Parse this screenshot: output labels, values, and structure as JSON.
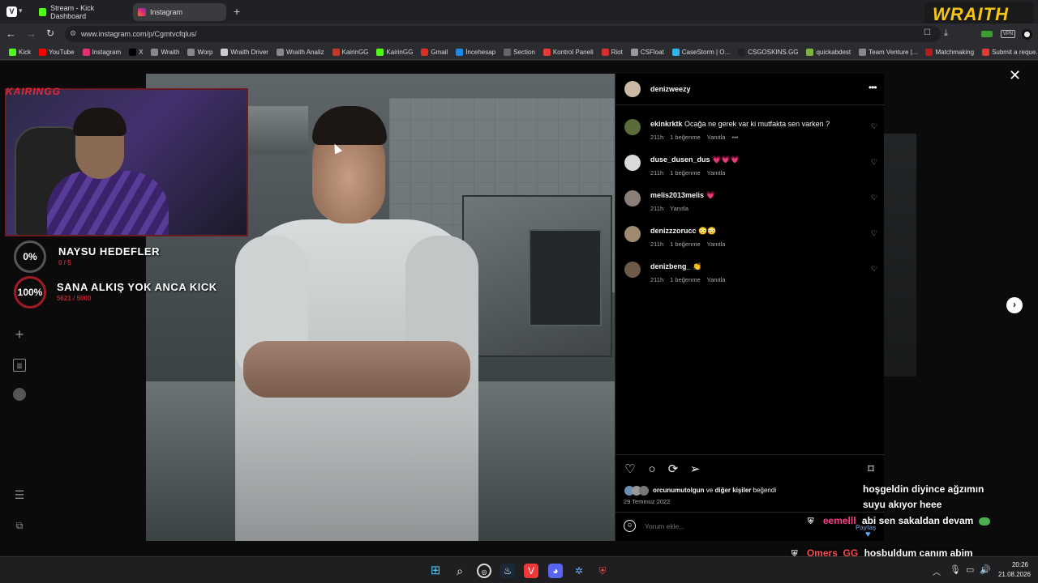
{
  "browser": {
    "tabs": [
      {
        "label": "Stream - Kick Dashboard",
        "color": "#53fc18"
      },
      {
        "label": "Instagram",
        "color": "#e1306c"
      }
    ],
    "new_tab": "+",
    "url": "www.instagram.com/p/Cgmtvcfqlus/",
    "bookmarks": [
      {
        "label": "Kick",
        "color": "#53fc18"
      },
      {
        "label": "YouTube",
        "color": "#ff0000"
      },
      {
        "label": "Instagram",
        "color": "#e1306c"
      },
      {
        "label": "X",
        "color": "#000000"
      },
      {
        "label": "Wraith",
        "color": "#888888"
      },
      {
        "label": "Worp",
        "color": "#888888"
      },
      {
        "label": "Wraith Driver",
        "color": "#cccccc"
      },
      {
        "label": "Wraith Analiz",
        "color": "#888888"
      },
      {
        "label": "KairinGG",
        "color": "#c0392b"
      },
      {
        "label": "KairinGG",
        "color": "#53fc18"
      },
      {
        "label": "Gmail",
        "color": "#d93025"
      },
      {
        "label": "İncehesap",
        "color": "#1e88e5"
      },
      {
        "label": "Section",
        "color": "#666666"
      },
      {
        "label": "Kontrol Paneli",
        "color": "#e53935"
      },
      {
        "label": "Riot",
        "color": "#d32f2f"
      },
      {
        "label": "CSFloat",
        "color": "#999999"
      },
      {
        "label": "CaseStorm | O...",
        "color": "#29b6f6"
      },
      {
        "label": "CSGOSKINS.GG",
        "color": "#222222"
      },
      {
        "label": "quickabdest",
        "color": "#7cb342"
      },
      {
        "label": "Team Venture |...",
        "color": "#888888"
      },
      {
        "label": "Matchmaking",
        "color": "#b71c1c"
      },
      {
        "label": "Submit a reque...",
        "color": "#e53935"
      }
    ]
  },
  "brand_logo": "WRAITH",
  "stream_overlay": {
    "webcam_label": "KAIRINGG",
    "goals": [
      {
        "percent": "0%",
        "title": "NAYSU HEDEFLER",
        "progress": "0 / 5"
      },
      {
        "percent": "100%",
        "title": "SANA ALKIŞ YOK ANCA KICK",
        "progress": "5621 / 5000"
      }
    ]
  },
  "post": {
    "author": "denizweezy",
    "comments": [
      {
        "user": "ekinkrktk",
        "text": "Ocağa ne gerek var ki mutfakta sen varken ?",
        "time": "211h",
        "likes": "1 beğenme",
        "reply": "Yanıtla",
        "more": "•••",
        "avatar_color": "#5b6b3a"
      },
      {
        "user": "duse_dusen_dus",
        "text": "💗💗💗",
        "time": "211h",
        "likes": "1 beğenme",
        "reply": "Yanıtla",
        "avatar_color": "#d9d9d9"
      },
      {
        "user": "melis2013melis",
        "text": "💗",
        "time": "211h",
        "likes": "",
        "reply": "Yanıtla",
        "avatar_color": "#8a7f79"
      },
      {
        "user": "denizzzorucc",
        "text": "😳😳",
        "time": "211h",
        "likes": "1 beğenme",
        "reply": "Yanıtla",
        "avatar_color": "#a08a70"
      },
      {
        "user": "denizbeng_",
        "text": "👏",
        "time": "211h",
        "likes": "1 beğenme",
        "reply": "Yanıtla",
        "avatar_color": "#6e5a48"
      }
    ],
    "liked_by_user": "orcunumutolgun",
    "liked_by_rest": "ve diğer kişiler beğendi",
    "liked_by_connector": "ve",
    "liked_by_others": "diğer kişiler",
    "liked_by_suffix": "beğendi",
    "date": "29 Temmuz 2022",
    "comment_placeholder": "Yorum ekle...",
    "share_label": "Paylaş"
  },
  "chat": [
    {
      "user": "",
      "message": "hoşgeldin diyince ağzımın",
      "color": "#ffffff"
    },
    {
      "user": "",
      "message": "suyu akıyor heee",
      "color": "#ffffff"
    },
    {
      "user": "eemelll",
      "message": "abi sen sakaldan devam",
      "color": "#ff3b8a"
    },
    {
      "user": "Omers_GG",
      "message": "hosbuldum canım abim",
      "color": "#ff4b4b"
    }
  ],
  "taskbar": {
    "time": "20:26",
    "date": "21.08.2026"
  },
  "colors": {
    "accent_kick": "#53fc18",
    "accent_red": "#c2212f",
    "brand_yellow": "#f5c518"
  }
}
